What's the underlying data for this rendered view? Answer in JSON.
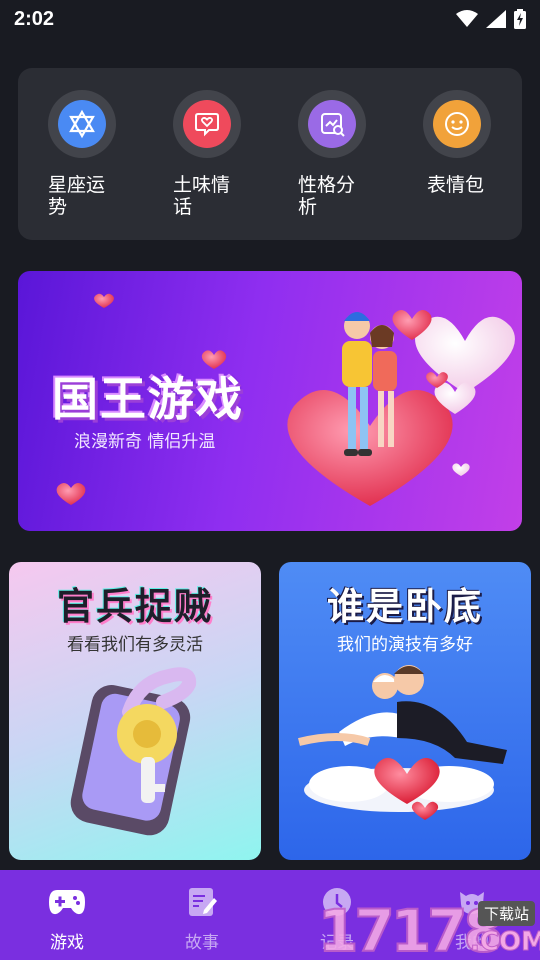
{
  "status_bar": {
    "time": "2:02"
  },
  "categories": [
    {
      "label": "星座运势",
      "icon": "star-of-david-icon",
      "color": "#4a8af3"
    },
    {
      "label": "土味情话",
      "icon": "chat-heart-icon",
      "color": "#ef4a5c"
    },
    {
      "label": "性格分析",
      "icon": "analysis-icon",
      "color": "#9a6ae6"
    },
    {
      "label": "表情包",
      "icon": "smiley-icon",
      "color": "#f1a23a"
    }
  ],
  "banner": {
    "title": "国王游戏",
    "subtitle": "浪漫新奇 情侣升温"
  },
  "games": [
    {
      "title": "官兵捉贼",
      "subtitle": "看看我们有多灵活"
    },
    {
      "title": "谁是卧底",
      "subtitle": "我们的演技有多好"
    }
  ],
  "tabs": [
    {
      "label": "游戏",
      "icon": "gamepad-icon",
      "active": true
    },
    {
      "label": "故事",
      "icon": "notebook-pen-icon",
      "active": false
    },
    {
      "label": "记录",
      "icon": "record-icon",
      "active": false
    },
    {
      "label": "我的",
      "icon": "profile-icon",
      "active": false
    }
  ],
  "watermark": {
    "number": "17178",
    "suffix": ".COM",
    "tag": "下载站"
  }
}
